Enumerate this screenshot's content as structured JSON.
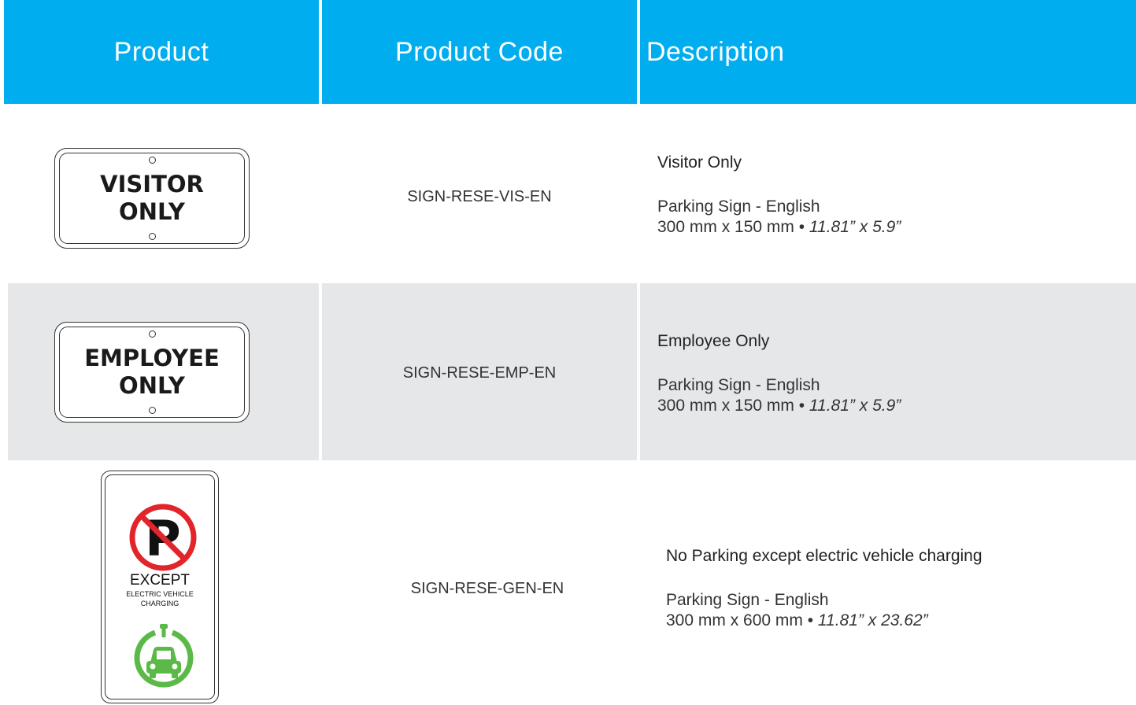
{
  "header": {
    "product": "Product",
    "product_code": "Product Code",
    "description": "Description"
  },
  "colors": {
    "header_bg": "#00aeef",
    "alt_row_bg": "#e6e7e8",
    "no_parking_red": "#e2242b",
    "ev_green": "#5bb947"
  },
  "rows": [
    {
      "sign_lines": [
        "VISITOR",
        "ONLY"
      ],
      "code": "SIGN-RESE-VIS-EN",
      "title": "Visitor Only",
      "type": "Parking Sign - English",
      "size_metric": "300 mm x 150 mm • ",
      "size_imperial": "11.81” x 5.9”"
    },
    {
      "sign_lines": [
        "EMPLOYEE",
        "ONLY"
      ],
      "code": "SIGN-RESE-EMP-EN",
      "title": "Employee Only",
      "type": "Parking Sign - English",
      "size_metric": "300 mm x 150 mm • ",
      "size_imperial": "11.81” x 5.9”"
    },
    {
      "sign_text": "EXCEPT",
      "sign_subtext_1": "ELECTRIC VEHICLE",
      "sign_subtext_2": "CHARGING",
      "sign_letter": "P",
      "code": "SIGN-RESE-GEN-EN",
      "title": "No Parking except electric vehicle charging",
      "type": "Parking Sign - English",
      "size_metric": "300 mm x 600 mm • ",
      "size_imperial": "11.81” x 23.62”"
    }
  ]
}
